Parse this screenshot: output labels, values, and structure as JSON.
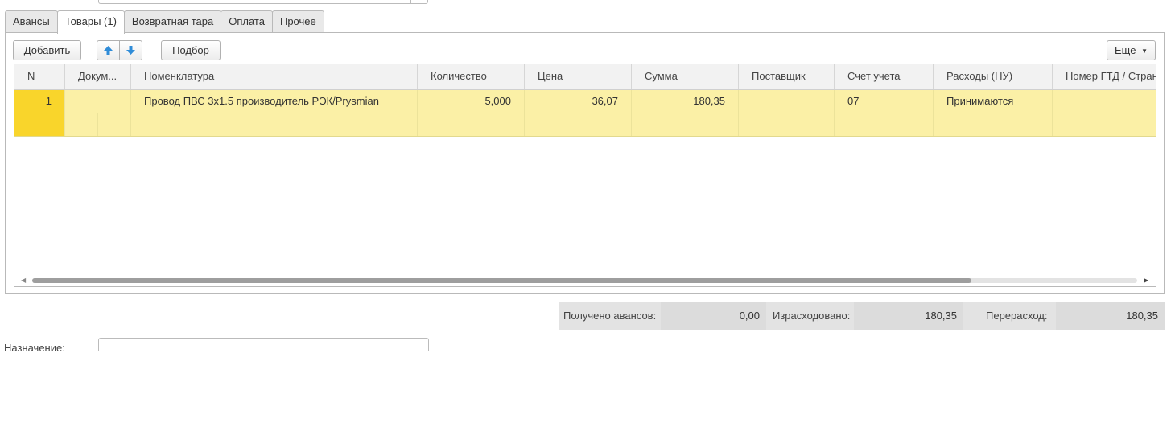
{
  "tabs": [
    {
      "label": "Авансы"
    },
    {
      "label": "Товары (1)"
    },
    {
      "label": "Возвратная тара"
    },
    {
      "label": "Оплата"
    },
    {
      "label": "Прочее"
    }
  ],
  "toolbar": {
    "add_label": "Добавить",
    "pick_label": "Подбор",
    "more_label": "Еще",
    "more_icon": "dropdown-arrow-icon",
    "up_icon": "arrow-up-icon",
    "down_icon": "arrow-down-icon",
    "arrow_color": "#2f8cd8"
  },
  "table": {
    "columns": [
      "N",
      "Докум...",
      "Номенклатура",
      "Количество",
      "Цена",
      "Сумма",
      "Поставщик",
      "Счет учета",
      "Расходы (НУ)",
      "Номер ГТД / Стран"
    ],
    "rows": [
      {
        "n": "1",
        "document": "",
        "nomenclature": "Провод ПВС 3х1.5 производитель РЭК/Prysmian",
        "quantity": "5,000",
        "price": "36,07",
        "sum": "180,35",
        "supplier": "",
        "account": "07",
        "expenses": "Принимаются",
        "gtd": ""
      }
    ],
    "selected_row_color": "#fbf0a6",
    "number_cell_color": "#f9d52b"
  },
  "totals": {
    "advances_label": "Получено авансов:",
    "advances_value": "0,00",
    "spent_label": "Израсходовано:",
    "spent_value": "180,35",
    "overspend_label": "Перерасход:",
    "overspend_value": "180,35"
  },
  "purpose": {
    "label": "Назначение:",
    "value": ""
  }
}
